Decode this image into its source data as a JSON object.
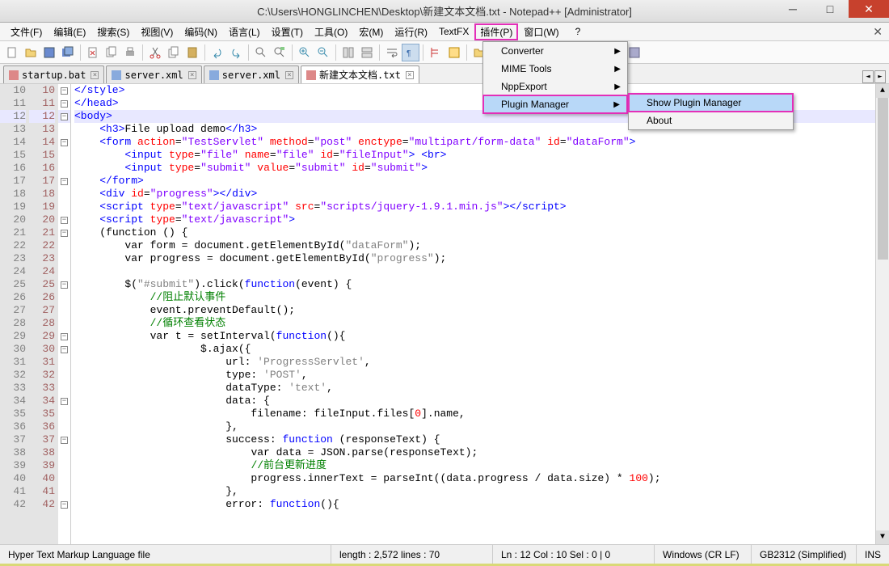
{
  "title": "C:\\Users\\HONGLINCHEN\\Desktop\\新建文本文档.txt - Notepad++ [Administrator]",
  "win": {
    "min": "─",
    "max": "□",
    "close": "✕"
  },
  "menu": [
    "文件(F)",
    "编辑(E)",
    "搜索(S)",
    "视图(V)",
    "编码(N)",
    "语言(L)",
    "设置(T)",
    "工具(O)",
    "宏(M)",
    "运行(R)",
    "TextFX",
    "插件(P)",
    "窗口(W)",
    "?"
  ],
  "tabs": [
    {
      "label": "startup.bat",
      "active": false,
      "ico": "red"
    },
    {
      "label": "server.xml",
      "active": false,
      "ico": "blue"
    },
    {
      "label": "server.xml",
      "active": false,
      "ico": "blue"
    },
    {
      "label": "新建文本文档.txt",
      "active": true,
      "ico": "red"
    }
  ],
  "dropdown": [
    "Converter",
    "MIME Tools",
    "NppExport",
    "Plugin Manager"
  ],
  "submenu": [
    "Show Plugin Manager",
    "About"
  ],
  "lines": [
    {
      "n": 10,
      "gn": 10,
      "fold": "-",
      "cls": "",
      "html": "</style>",
      "toks": [
        [
          "</style>",
          "t-blue"
        ]
      ]
    },
    {
      "n": 11,
      "gn": 11,
      "fold": "-",
      "cls": "",
      "toks": [
        [
          "</head>",
          "t-blue"
        ]
      ]
    },
    {
      "n": 12,
      "gn": 12,
      "fold": "-",
      "cls": "hl",
      "toks": [
        [
          "<body>",
          "t-blue"
        ]
      ]
    },
    {
      "n": 13,
      "gn": 13,
      "fold": "",
      "cls": "",
      "toks": [
        [
          "    ",
          ""
        ],
        [
          "<h3>",
          "t-blue"
        ],
        [
          "File upload demo",
          ""
        ],
        [
          "</h3>",
          "t-blue"
        ]
      ]
    },
    {
      "n": 14,
      "gn": 14,
      "fold": "-",
      "cls": "",
      "toks": [
        [
          "    ",
          ""
        ],
        [
          "<form ",
          "t-blue"
        ],
        [
          "action",
          "t-red"
        ],
        [
          "=",
          ""
        ],
        [
          "\"TestServlet\"",
          "t-purple"
        ],
        [
          " ",
          ""
        ],
        [
          "method",
          "t-red"
        ],
        [
          "=",
          ""
        ],
        [
          "\"post\"",
          "t-purple"
        ],
        [
          " ",
          ""
        ],
        [
          "enctype",
          "t-red"
        ],
        [
          "=",
          ""
        ],
        [
          "\"multipart/form-data\"",
          "t-purple"
        ],
        [
          " ",
          ""
        ],
        [
          "id",
          "t-red"
        ],
        [
          "=",
          ""
        ],
        [
          "\"dataForm\"",
          "t-purple"
        ],
        [
          ">",
          "t-blue"
        ]
      ]
    },
    {
      "n": 15,
      "gn": 15,
      "fold": "",
      "cls": "",
      "toks": [
        [
          "        ",
          ""
        ],
        [
          "<input ",
          "t-blue"
        ],
        [
          "type",
          "t-red"
        ],
        [
          "=",
          ""
        ],
        [
          "\"file\"",
          "t-purple"
        ],
        [
          " ",
          ""
        ],
        [
          "name",
          "t-red"
        ],
        [
          "=",
          ""
        ],
        [
          "\"file\"",
          "t-purple"
        ],
        [
          " ",
          ""
        ],
        [
          "id",
          "t-red"
        ],
        [
          "=",
          ""
        ],
        [
          "\"fileInput\"",
          "t-purple"
        ],
        [
          ">",
          "t-blue"
        ],
        [
          " ",
          ""
        ],
        [
          "<br>",
          "t-blue"
        ]
      ]
    },
    {
      "n": 16,
      "gn": 16,
      "fold": "",
      "cls": "",
      "toks": [
        [
          "        ",
          ""
        ],
        [
          "<input ",
          "t-blue"
        ],
        [
          "type",
          "t-red"
        ],
        [
          "=",
          ""
        ],
        [
          "\"submit\"",
          "t-purple"
        ],
        [
          " ",
          ""
        ],
        [
          "value",
          "t-red"
        ],
        [
          "=",
          ""
        ],
        [
          "\"submit\"",
          "t-purple"
        ],
        [
          " ",
          ""
        ],
        [
          "id",
          "t-red"
        ],
        [
          "=",
          ""
        ],
        [
          "\"submit\"",
          "t-purple"
        ],
        [
          ">",
          "t-blue"
        ]
      ]
    },
    {
      "n": 17,
      "gn": 17,
      "fold": "-",
      "cls": "",
      "toks": [
        [
          "    ",
          ""
        ],
        [
          "</form>",
          "t-blue"
        ]
      ]
    },
    {
      "n": 18,
      "gn": 18,
      "fold": "",
      "cls": "",
      "toks": [
        [
          "    ",
          ""
        ],
        [
          "<div ",
          "t-blue"
        ],
        [
          "id",
          "t-red"
        ],
        [
          "=",
          ""
        ],
        [
          "\"progress\"",
          "t-purple"
        ],
        [
          "></div>",
          "t-blue"
        ]
      ]
    },
    {
      "n": 19,
      "gn": 19,
      "fold": "",
      "cls": "",
      "toks": [
        [
          "    ",
          ""
        ],
        [
          "<script ",
          "t-blue"
        ],
        [
          "type",
          "t-red"
        ],
        [
          "=",
          ""
        ],
        [
          "\"text/javascript\"",
          "t-purple"
        ],
        [
          " ",
          ""
        ],
        [
          "src",
          "t-red"
        ],
        [
          "=",
          ""
        ],
        [
          "\"scripts/jquery-1.9.1.min.js\"",
          "t-purple"
        ],
        [
          "></scr",
          "t-blue"
        ],
        [
          "ipt>",
          "t-blue"
        ]
      ]
    },
    {
      "n": 20,
      "gn": 20,
      "fold": "-",
      "cls": "",
      "toks": [
        [
          "    ",
          ""
        ],
        [
          "<script ",
          "t-blue"
        ],
        [
          "type",
          "t-red"
        ],
        [
          "=",
          ""
        ],
        [
          "\"text/javascript\"",
          "t-purple"
        ],
        [
          ">",
          "t-blue"
        ]
      ]
    },
    {
      "n": 21,
      "gn": 21,
      "fold": "-",
      "cls": "",
      "toks": [
        [
          "    (",
          ""
        ],
        [
          "function",
          ""
        ],
        [
          " () {",
          ""
        ]
      ]
    },
    {
      "n": 22,
      "gn": 22,
      "fold": "",
      "cls": "",
      "toks": [
        [
          "        ",
          ""
        ],
        [
          "var",
          ""
        ],
        [
          " form = document.getElementById(",
          ""
        ],
        [
          "\"dataForm\"",
          "t-grey"
        ],
        [
          ");",
          ""
        ]
      ]
    },
    {
      "n": 23,
      "gn": 23,
      "fold": "",
      "cls": "",
      "toks": [
        [
          "        ",
          ""
        ],
        [
          "var",
          ""
        ],
        [
          " progress = document.getElementById(",
          ""
        ],
        [
          "\"progress\"",
          "t-grey"
        ],
        [
          ");",
          ""
        ]
      ]
    },
    {
      "n": 24,
      "gn": 24,
      "fold": "",
      "cls": "",
      "toks": []
    },
    {
      "n": 25,
      "gn": 25,
      "fold": "-",
      "cls": "",
      "toks": [
        [
          "        $(",
          ""
        ],
        [
          "\"#submit\"",
          "t-grey"
        ],
        [
          ").click(",
          ""
        ],
        [
          "function",
          "t-blue"
        ],
        [
          "(event) {",
          ""
        ]
      ]
    },
    {
      "n": 26,
      "gn": 26,
      "fold": "",
      "cls": "",
      "toks": [
        [
          "            ",
          ""
        ],
        [
          "//阻止默认事件",
          "t-green"
        ]
      ]
    },
    {
      "n": 27,
      "gn": 27,
      "fold": "",
      "cls": "",
      "toks": [
        [
          "            event.preventDefault();",
          ""
        ]
      ]
    },
    {
      "n": 28,
      "gn": 28,
      "fold": "",
      "cls": "",
      "toks": [
        [
          "            ",
          ""
        ],
        [
          "//循环查看状态",
          "t-green"
        ]
      ]
    },
    {
      "n": 29,
      "gn": 29,
      "fold": "-",
      "cls": "",
      "toks": [
        [
          "            ",
          ""
        ],
        [
          "var",
          ""
        ],
        [
          " t = setInterval(",
          ""
        ],
        [
          "function",
          "t-blue"
        ],
        [
          "(){",
          ""
        ]
      ]
    },
    {
      "n": 30,
      "gn": 30,
      "fold": "-",
      "cls": "",
      "toks": [
        [
          "                    $.ajax({",
          ""
        ]
      ]
    },
    {
      "n": 31,
      "gn": 31,
      "fold": "",
      "cls": "",
      "toks": [
        [
          "                        url: ",
          ""
        ],
        [
          "'ProgressServlet'",
          "t-grey"
        ],
        [
          ",",
          ""
        ]
      ]
    },
    {
      "n": 32,
      "gn": 32,
      "fold": "",
      "cls": "",
      "toks": [
        [
          "                        type: ",
          ""
        ],
        [
          "'POST'",
          "t-grey"
        ],
        [
          ",",
          ""
        ]
      ]
    },
    {
      "n": 33,
      "gn": 33,
      "fold": "",
      "cls": "",
      "toks": [
        [
          "                        dataType: ",
          ""
        ],
        [
          "'text'",
          "t-grey"
        ],
        [
          ",",
          ""
        ]
      ]
    },
    {
      "n": 34,
      "gn": 34,
      "fold": "-",
      "cls": "",
      "toks": [
        [
          "                        data: {",
          ""
        ]
      ]
    },
    {
      "n": 35,
      "gn": 35,
      "fold": "",
      "cls": "",
      "toks": [
        [
          "                            filename: fileInput.files[",
          ""
        ],
        [
          "0",
          "t-red"
        ],
        [
          "].name,",
          ""
        ]
      ]
    },
    {
      "n": 36,
      "gn": 36,
      "fold": "",
      "cls": "",
      "toks": [
        [
          "                        },",
          ""
        ]
      ]
    },
    {
      "n": 37,
      "gn": 37,
      "fold": "-",
      "cls": "",
      "toks": [
        [
          "                        success: ",
          ""
        ],
        [
          "function",
          "t-blue"
        ],
        [
          " (responseText) {",
          ""
        ]
      ]
    },
    {
      "n": 38,
      "gn": 38,
      "fold": "",
      "cls": "",
      "toks": [
        [
          "                            ",
          ""
        ],
        [
          "var",
          ""
        ],
        [
          " data = JSON.parse(responseText);",
          ""
        ]
      ]
    },
    {
      "n": 39,
      "gn": 39,
      "fold": "",
      "cls": "",
      "toks": [
        [
          "                            ",
          ""
        ],
        [
          "//前台更新进度",
          "t-green"
        ]
      ]
    },
    {
      "n": 40,
      "gn": 40,
      "fold": "",
      "cls": "",
      "toks": [
        [
          "                            progress.innerText = parseInt((data.progress / data.size) * ",
          ""
        ],
        [
          "100",
          "t-red"
        ],
        [
          ");",
          ""
        ]
      ]
    },
    {
      "n": 41,
      "gn": 41,
      "fold": "",
      "cls": "",
      "toks": [
        [
          "                        },",
          ""
        ]
      ]
    },
    {
      "n": 42,
      "gn": 42,
      "fold": "-",
      "cls": "",
      "toks": [
        [
          "                        error: ",
          ""
        ],
        [
          "function",
          "t-blue"
        ],
        [
          "(){",
          ""
        ]
      ]
    }
  ],
  "status": {
    "lang": "Hyper Text Markup Language file",
    "len": "length : 2,572    lines : 70",
    "pos": "Ln : 12    Col : 10    Sel : 0 | 0",
    "eol": "Windows (CR LF)",
    "enc": "GB2312 (Simplified)",
    "ins": "INS"
  }
}
